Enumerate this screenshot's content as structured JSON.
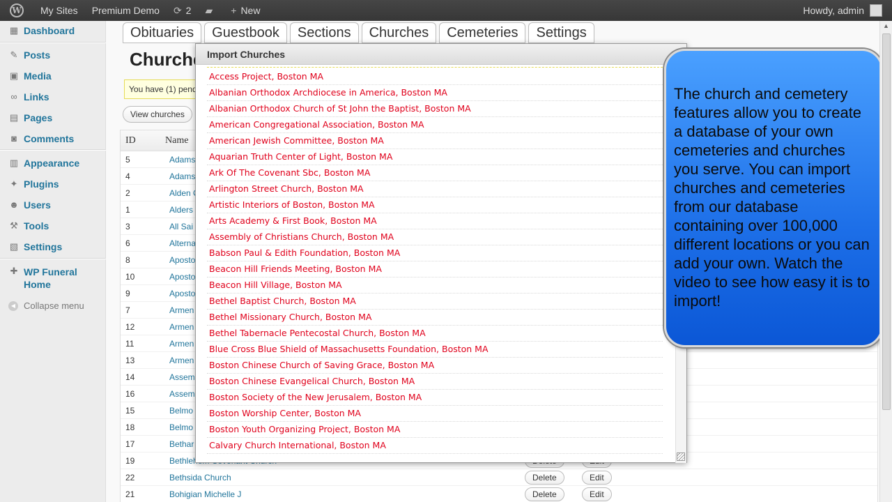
{
  "adminbar": {
    "my_sites": "My Sites",
    "site_name": "Premium Demo",
    "updates_count": "2",
    "new_label": "New",
    "howdy": "Howdy, admin"
  },
  "sidebar": {
    "items": [
      {
        "label": "Dashboard",
        "icon": "dashboard-icon"
      },
      {
        "label": "Posts",
        "icon": "pushpin-icon"
      },
      {
        "label": "Media",
        "icon": "media-icon"
      },
      {
        "label": "Links",
        "icon": "link-icon"
      },
      {
        "label": "Pages",
        "icon": "page-icon"
      },
      {
        "label": "Comments",
        "icon": "comment-icon"
      },
      {
        "label": "Appearance",
        "icon": "appearance-icon"
      },
      {
        "label": "Plugins",
        "icon": "plugin-icon"
      },
      {
        "label": "Users",
        "icon": "users-icon"
      },
      {
        "label": "Tools",
        "icon": "tools-icon"
      },
      {
        "label": "Settings",
        "icon": "settings-icon"
      },
      {
        "label": "WP Funeral Home",
        "icon": "funeral-home-icon"
      }
    ],
    "collapse_label": "Collapse menu"
  },
  "tabs": [
    "Obituaries",
    "Guestbook",
    "Sections",
    "Churches",
    "Cemeteries",
    "Settings"
  ],
  "page_title": "Churche",
  "notice": "You have (1) pend",
  "view_button": "View churches",
  "table": {
    "columns": {
      "id": "ID",
      "name": "Name"
    },
    "delete_label": "Delete",
    "edit_label": "Edit",
    "rows": [
      {
        "id": "5",
        "name": "Adams"
      },
      {
        "id": "4",
        "name": "Adams"
      },
      {
        "id": "2",
        "name": "Alden C"
      },
      {
        "id": "1",
        "name": "Alders"
      },
      {
        "id": "3",
        "name": "All Sai"
      },
      {
        "id": "6",
        "name": "Alterna"
      },
      {
        "id": "8",
        "name": "Aposto"
      },
      {
        "id": "10",
        "name": "Aposto"
      },
      {
        "id": "9",
        "name": "Aposto"
      },
      {
        "id": "7",
        "name": "Armen"
      },
      {
        "id": "12",
        "name": "Armen"
      },
      {
        "id": "11",
        "name": "Armen"
      },
      {
        "id": "13",
        "name": "Armen"
      },
      {
        "id": "14",
        "name": "Assem"
      },
      {
        "id": "16",
        "name": "Assem"
      },
      {
        "id": "15",
        "name": "Belmo"
      },
      {
        "id": "18",
        "name": "Belmo"
      },
      {
        "id": "17",
        "name": "Bethar"
      },
      {
        "id": "19",
        "name": "Bethlehem Covenant Church"
      },
      {
        "id": "22",
        "name": "Bethsida Church"
      },
      {
        "id": "21",
        "name": "Bohigian Michelle J"
      }
    ]
  },
  "dialog": {
    "title": "Import Churches",
    "close": "×",
    "churches": [
      "Access Project, Boston MA",
      "Albanian Orthodox Archdiocese in America, Boston MA",
      "Albanian Orthodox Church of St John the Baptist, Boston MA",
      "American Congregational Association, Boston MA",
      "American Jewish Committee, Boston MA",
      "Aquarian Truth Center of Light, Boston MA",
      "Ark Of The Covenant Sbc, Boston MA",
      "Arlington Street Church, Boston MA",
      "Artistic Interiors of Boston, Boston MA",
      "Arts Academy & First Book, Boston MA",
      "Assembly of Christians Church, Boston MA",
      "Babson Paul & Edith Foundation, Boston MA",
      "Beacon Hill Friends Meeting, Boston MA",
      "Beacon Hill Village, Boston MA",
      "Bethel Baptist Church, Boston MA",
      "Bethel Missionary Church, Boston MA",
      "Bethel Tabernacle Pentecostal Church, Boston MA",
      "Blue Cross Blue Shield of Massachusetts Foundation, Boston MA",
      "Boston Chinese Church of Saving Grace, Boston MA",
      "Boston Chinese Evangelical Church, Boston MA",
      "Boston Society of the New Jerusalem, Boston MA",
      "Boston Worship Center, Boston MA",
      "Boston Youth Organizing Project, Boston MA",
      "Calvary Church International, Boston MA"
    ]
  },
  "callout": {
    "text": "The church and cemetery features allow you to create a database of your own cemeteries and churches you serve. You can import churches and cemeteries from our database containing over 100,000 different locations or you can add your own. Watch the video to see how easy it is to import!",
    "color": "#1d6fe8"
  }
}
